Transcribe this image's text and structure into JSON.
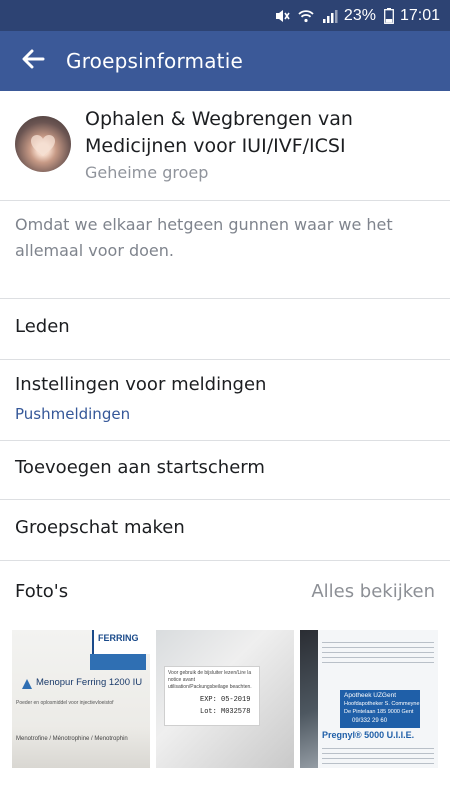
{
  "status_bar": {
    "battery_percent": "23%",
    "time": "17:01",
    "icons": [
      "mute-icon",
      "wifi-icon",
      "signal-icon",
      "battery-icon"
    ]
  },
  "header": {
    "title": "Groepsinformatie",
    "back_icon": "arrow-left-icon"
  },
  "group": {
    "name": "Ophalen & Wegbrengen van Medicijnen voor IUI/IVF/ICSI",
    "privacy": "Geheime groep",
    "description": "Omdat we elkaar hetgeen gunnen waar we het allemaal voor doen."
  },
  "menu": {
    "members": "Leden",
    "notifications": "Instellingen voor meldingen",
    "notifications_sub": "Pushmeldingen",
    "add_home": "Toevoegen aan startscherm",
    "group_chat": "Groepschat maken"
  },
  "photos": {
    "title": "Foto's",
    "see_all": "Alles bekijken",
    "items": [
      {
        "brand": "FERRING",
        "product": "Menopur Ferring 1200 IU",
        "line1": "Poeder en oplosmiddel voor injectievloeistof",
        "line2": "Menotrofine / Ménotrophine / Menotrophin"
      },
      {
        "notice": "Voor gebruik de bijsluiter lezen/Lire la notice avant utilisation/Packungsbeilage beachten.",
        "exp": "EXP: 05-2019",
        "lot": "Lot: M032578"
      },
      {
        "product": "Pregnyl® 5000 U.I.I.E.",
        "pharmacy": "Apotheek UZGent",
        "address": "Hoofdapotheker S. Commeyne",
        "street": "De Pintelaan 185 9000 Gent",
        "phone": "09/332 29 60"
      }
    ]
  },
  "colors": {
    "status_bar": "#2d4373",
    "app_bar": "#3b5998",
    "link": "#365899",
    "muted_text": "#90949c"
  }
}
